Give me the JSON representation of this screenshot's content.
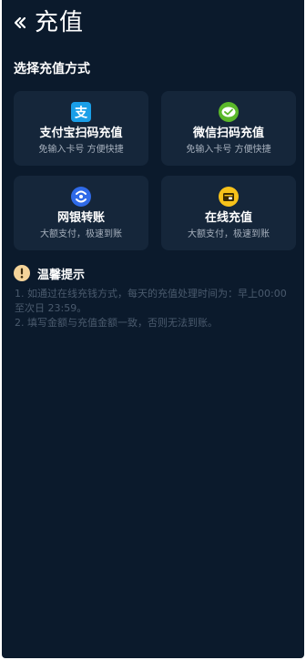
{
  "header": {
    "title": "充值"
  },
  "section": {
    "title": "选择充值方式"
  },
  "methods": [
    {
      "label": "支付宝扫码充值",
      "sub": "免输入卡号 方便快捷",
      "icon": "alipay-icon",
      "color": "#1a9fe8"
    },
    {
      "label": "微信扫码充值",
      "sub": "免输入卡号 方便快捷",
      "icon": "wechat-icon",
      "color": "#5bb82a"
    },
    {
      "label": "网银转账",
      "sub": "大额支付，极速到账",
      "icon": "bank-transfer-icon",
      "color": "#2f6ae8"
    },
    {
      "label": "在线充值",
      "sub": "大额支付，极速到账",
      "icon": "online-wallet-icon",
      "color": "#f7c21a"
    }
  ],
  "tips": {
    "title": "温馨提示",
    "icon": "exclamation-icon",
    "lines": [
      "1. 如通过在线充钱方式，每天的充值处理时间为：早上00:00 至次日 23:59。",
      "2. 填写金额与充值金额一致，否则无法到账。"
    ]
  }
}
